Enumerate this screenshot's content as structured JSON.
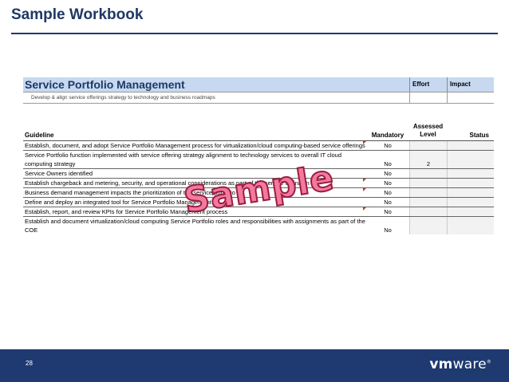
{
  "slide": {
    "title": "Sample Workbook",
    "page_number": "28"
  },
  "sheet": {
    "section_title": "Service Portfolio Management",
    "effort_label": "Effort",
    "impact_label": "Impact",
    "subtitle": "Develop & align service offerings strategy to technology and business roadmaps",
    "columns": {
      "guideline": "Guideline",
      "mandatory": "Mandatory",
      "assessed_line1": "Assessed",
      "assessed_line2": "Level",
      "status": "Status"
    },
    "rows": [
      {
        "guideline": "Establish, document, and adopt Service Portfolio Management process for virtualization/cloud computing-based service offerings",
        "mandatory": "No",
        "level": ""
      },
      {
        "guideline": "Service Portfolio function implemented with service offering strategy alignment to technology services to overall IT cloud computing strategy",
        "mandatory": "No",
        "level": "2"
      },
      {
        "guideline": "Service Owners identified",
        "mandatory": "No",
        "level": ""
      },
      {
        "guideline": "Establish chargeback and metering, security, and operational considerations as part of the service definition",
        "mandatory": "No",
        "level": ""
      },
      {
        "guideline": "Business demand management impacts the prioritization of the service portfolio",
        "mandatory": "No",
        "level": ""
      },
      {
        "guideline": "Define and deploy an integrated tool for Service Portfolio Management",
        "mandatory": "No",
        "level": ""
      },
      {
        "guideline": "Establish, report, and review KPIs for Service Portfolio Management process",
        "mandatory": "No",
        "level": ""
      },
      {
        "guideline": "Establish and document virtualization/cloud computing Service Portfolio roles and responsibilities with assignments as part of the COE",
        "mandatory": "No",
        "level": ""
      }
    ]
  },
  "watermark": "Sample",
  "logo": {
    "prefix": "vm",
    "suffix": "ware",
    "mark": "®"
  },
  "colors": {
    "title": "#1f3864",
    "header_fill": "#c6d9f1",
    "footer": "#1f3a70",
    "watermark": "#f47a9c"
  }
}
